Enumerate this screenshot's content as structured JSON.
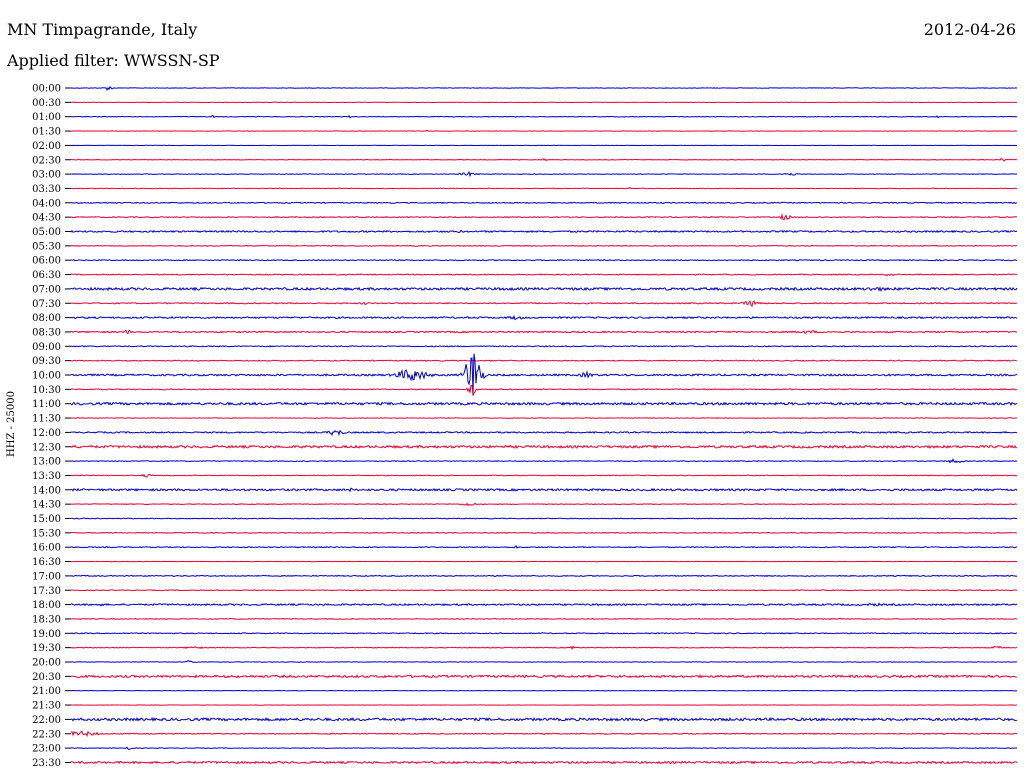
{
  "header": {
    "station": "MN Timpagrande, Italy",
    "date": "2012-04-26",
    "filter_label": "Applied filter: WWSSN-SP"
  },
  "chart_data": {
    "type": "line",
    "title": "MN Timpagrande, Italy",
    "subtitle": "Applied filter: WWSSN-SP",
    "date": "2012-04-26",
    "ylabel": "HHZ - 25000",
    "xlabel": "",
    "colors": {
      "even_rows": "#0000cc",
      "odd_rows": "#ee0033"
    },
    "rows": [
      {
        "label": "00:00",
        "noise": 0.3,
        "bursts": [
          {
            "x": 0.04,
            "w": 0.004,
            "amp": 2.5
          }
        ]
      },
      {
        "label": "00:30",
        "noise": 0.2,
        "bursts": []
      },
      {
        "label": "01:00",
        "noise": 0.3,
        "bursts": [
          {
            "x": 0.15,
            "w": 0.002,
            "amp": 1.5
          },
          {
            "x": 0.295,
            "w": 0.002,
            "amp": 1.5
          },
          {
            "x": 0.915,
            "w": 0.002,
            "amp": 1.5
          }
        ]
      },
      {
        "label": "01:30",
        "noise": 0.2,
        "bursts": [
          {
            "x": 0.375,
            "w": 0.002,
            "amp": 1.5
          }
        ]
      },
      {
        "label": "02:00",
        "noise": 0.2,
        "bursts": []
      },
      {
        "label": "02:30",
        "noise": 0.3,
        "bursts": [
          {
            "x": 0.5,
            "w": 0.003,
            "amp": 1.5
          },
          {
            "x": 0.985,
            "w": 0.003,
            "amp": 2
          }
        ]
      },
      {
        "label": "03:00",
        "noise": 0.3,
        "bursts": [
          {
            "x": 0.42,
            "w": 0.01,
            "amp": 2
          },
          {
            "x": 0.76,
            "w": 0.01,
            "amp": 1.5
          }
        ]
      },
      {
        "label": "03:30",
        "noise": 0.3,
        "bursts": [
          {
            "x": 0.59,
            "w": 0.002,
            "amp": 1.2
          }
        ]
      },
      {
        "label": "04:00",
        "noise": 0.5,
        "bursts": []
      },
      {
        "label": "04:30",
        "noise": 0.5,
        "bursts": [
          {
            "x": 0.755,
            "w": 0.006,
            "amp": 3
          }
        ]
      },
      {
        "label": "05:00",
        "noise": 0.8,
        "bursts": [
          {
            "x": 0.41,
            "w": 0.004,
            "amp": 1.5
          }
        ]
      },
      {
        "label": "05:30",
        "noise": 0.4,
        "bursts": []
      },
      {
        "label": "06:00",
        "noise": 0.5,
        "bursts": []
      },
      {
        "label": "06:30",
        "noise": 0.5,
        "bursts": [
          {
            "x": 0.865,
            "w": 0.006,
            "amp": 1.5
          }
        ]
      },
      {
        "label": "07:00",
        "noise": 1.2,
        "bursts": [
          {
            "x": 0.46,
            "w": 0.006,
            "amp": 2.5
          },
          {
            "x": 0.85,
            "w": 0.02,
            "amp": 2
          }
        ]
      },
      {
        "label": "07:30",
        "noise": 0.6,
        "bursts": [
          {
            "x": 0.31,
            "w": 0.003,
            "amp": 2
          },
          {
            "x": 0.72,
            "w": 0.01,
            "amp": 3
          }
        ]
      },
      {
        "label": "08:00",
        "noise": 0.8,
        "bursts": [
          {
            "x": 0.47,
            "w": 0.01,
            "amp": 2
          }
        ]
      },
      {
        "label": "08:30",
        "noise": 0.7,
        "bursts": [
          {
            "x": 0.06,
            "w": 0.006,
            "amp": 2
          },
          {
            "x": 0.78,
            "w": 0.015,
            "amp": 1.5
          }
        ]
      },
      {
        "label": "09:00",
        "noise": 0.5,
        "bursts": []
      },
      {
        "label": "09:30",
        "noise": 0.5,
        "bursts": []
      },
      {
        "label": "10:00",
        "noise": 0.9,
        "bursts": [
          {
            "x": 0.36,
            "w": 0.018,
            "amp": 6
          },
          {
            "x": 0.425,
            "w": 0.008,
            "amp": 28
          },
          {
            "x": 0.545,
            "w": 0.008,
            "amp": 3
          }
        ]
      },
      {
        "label": "10:30",
        "noise": 0.5,
        "bursts": [
          {
            "x": 0.424,
            "w": 0.004,
            "amp": 8
          }
        ]
      },
      {
        "label": "11:00",
        "noise": 1.2,
        "bursts": []
      },
      {
        "label": "11:30",
        "noise": 0.3,
        "bursts": []
      },
      {
        "label": "12:00",
        "noise": 0.7,
        "bursts": [
          {
            "x": 0.28,
            "w": 0.01,
            "amp": 3
          }
        ]
      },
      {
        "label": "12:30",
        "noise": 1.2,
        "bursts": []
      },
      {
        "label": "13:00",
        "noise": 0.4,
        "bursts": [
          {
            "x": 0.935,
            "w": 0.01,
            "amp": 2
          }
        ]
      },
      {
        "label": "13:30",
        "noise": 0.4,
        "bursts": [
          {
            "x": 0.08,
            "w": 0.008,
            "amp": 1.5
          }
        ]
      },
      {
        "label": "14:00",
        "noise": 1.0,
        "bursts": [
          {
            "x": 0.295,
            "w": 0.003,
            "amp": 2
          }
        ]
      },
      {
        "label": "14:30",
        "noise": 0.4,
        "bursts": [
          {
            "x": 0.42,
            "w": 0.008,
            "amp": 2
          }
        ]
      },
      {
        "label": "15:00",
        "noise": 0.4,
        "bursts": []
      },
      {
        "label": "15:30",
        "noise": 0.4,
        "bursts": []
      },
      {
        "label": "16:00",
        "noise": 0.5,
        "bursts": [
          {
            "x": 0.47,
            "w": 0.002,
            "amp": 2
          }
        ]
      },
      {
        "label": "16:30",
        "noise": 0.2,
        "bursts": []
      },
      {
        "label": "17:00",
        "noise": 0.5,
        "bursts": []
      },
      {
        "label": "17:30",
        "noise": 0.4,
        "bursts": []
      },
      {
        "label": "18:00",
        "noise": 0.8,
        "bursts": [
          {
            "x": 0.03,
            "w": 0.006,
            "amp": 1.5
          },
          {
            "x": 0.85,
            "w": 0.01,
            "amp": 1.5
          }
        ]
      },
      {
        "label": "18:30",
        "noise": 0.4,
        "bursts": [
          {
            "x": 0.8,
            "w": 0.003,
            "amp": 1.5
          }
        ]
      },
      {
        "label": "19:00",
        "noise": 0.5,
        "bursts": []
      },
      {
        "label": "19:30",
        "noise": 0.4,
        "bursts": [
          {
            "x": 0.13,
            "w": 0.01,
            "amp": 1.5
          },
          {
            "x": 0.53,
            "w": 0.004,
            "amp": 2
          },
          {
            "x": 0.98,
            "w": 0.008,
            "amp": 1.5
          }
        ]
      },
      {
        "label": "20:00",
        "noise": 0.3,
        "bursts": [
          {
            "x": 0.125,
            "w": 0.004,
            "amp": 2
          }
        ]
      },
      {
        "label": "20:30",
        "noise": 1.1,
        "bursts": []
      },
      {
        "label": "21:00",
        "noise": 0.2,
        "bursts": []
      },
      {
        "label": "21:30",
        "noise": 0.2,
        "bursts": []
      },
      {
        "label": "22:00",
        "noise": 1.3,
        "bursts": []
      },
      {
        "label": "22:30",
        "noise": 0.5,
        "bursts": [
          {
            "x": 0.01,
            "w": 0.02,
            "amp": 2.5
          }
        ]
      },
      {
        "label": "23:00",
        "noise": 0.3,
        "bursts": [
          {
            "x": 0.06,
            "w": 0.004,
            "amp": 2
          }
        ]
      },
      {
        "label": "23:30",
        "noise": 1.0,
        "bursts": []
      }
    ]
  }
}
